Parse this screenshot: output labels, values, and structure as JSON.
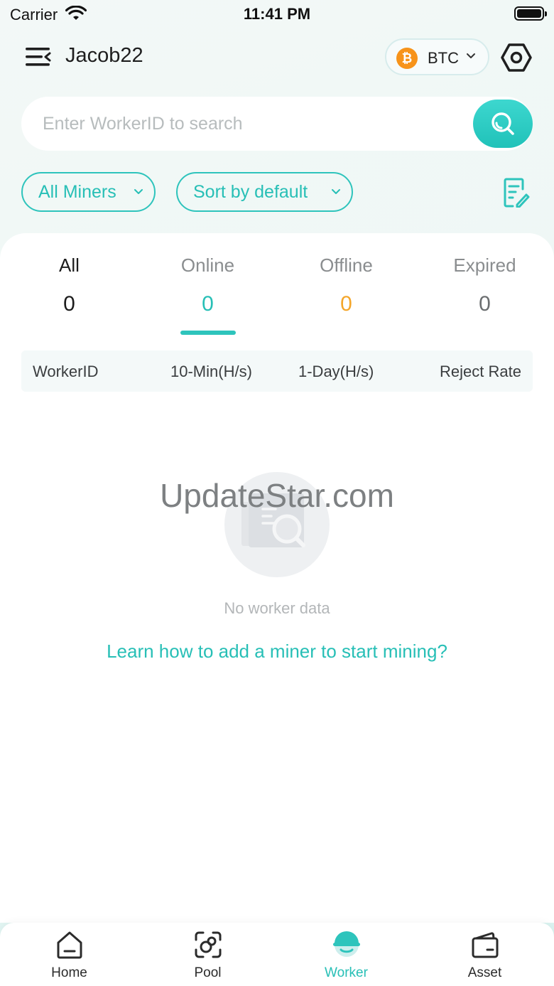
{
  "status_bar": {
    "carrier": "Carrier",
    "time": "11:41 PM"
  },
  "header": {
    "username": "Jacob22",
    "coin": "BTC",
    "coin_symbol": "₿"
  },
  "search": {
    "placeholder": "Enter WorkerID to search"
  },
  "filters": {
    "miners": "All Miners",
    "sort": "Sort by default"
  },
  "tabs": [
    {
      "label": "All",
      "count": "0"
    },
    {
      "label": "Online",
      "count": "0"
    },
    {
      "label": "Offline",
      "count": "0"
    },
    {
      "label": "Expired",
      "count": "0"
    }
  ],
  "table": {
    "columns": [
      "WorkerID",
      "10-Min(H/s)",
      "1-Day(H/s)",
      "Reject Rate"
    ]
  },
  "empty": {
    "watermark": "UpdateStar.com",
    "message": "No worker data",
    "link": "Learn how to add a miner to start mining?"
  },
  "nav": [
    {
      "label": "Home",
      "icon": "home-icon"
    },
    {
      "label": "Pool",
      "icon": "pool-icon"
    },
    {
      "label": "Worker",
      "icon": "worker-icon"
    },
    {
      "label": "Asset",
      "icon": "wallet-icon"
    }
  ],
  "colors": {
    "accent": "#2ec4bc",
    "offline": "#f4a62a",
    "coin": "#f7931a"
  }
}
